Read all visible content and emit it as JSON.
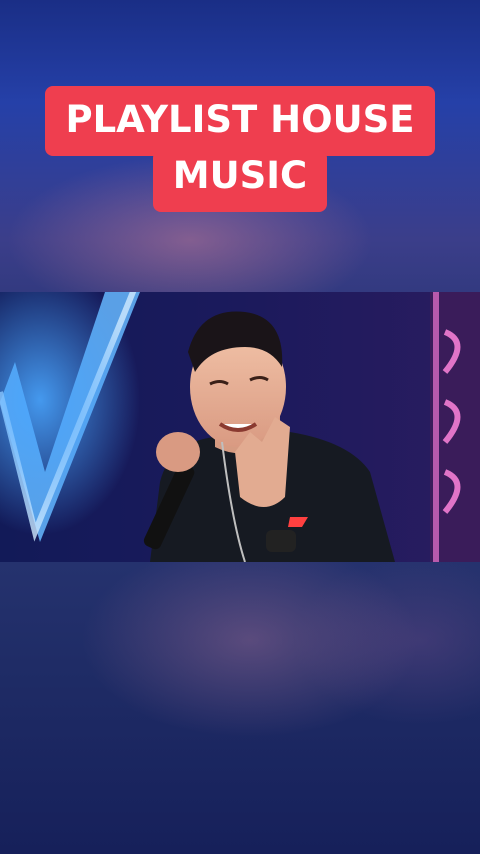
{
  "caption": {
    "line1": "PLAYLIST HOUSE",
    "line2": "MUSIC"
  },
  "video": {
    "description_icon": "performer-singing-image"
  },
  "colors": {
    "caption_bg": "#ef3e4f",
    "caption_text": "#ffffff",
    "background": "#1b2a6b"
  }
}
